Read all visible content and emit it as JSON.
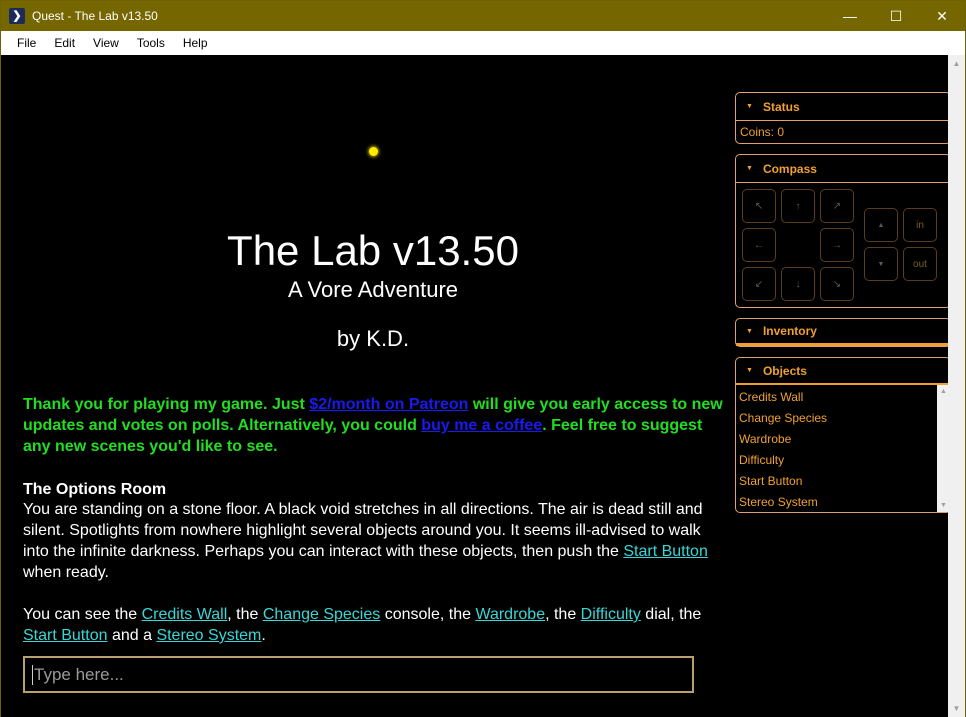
{
  "window": {
    "app_icon": "quest-icon",
    "title": "Quest - The Lab v13.50",
    "controls": {
      "minimize": "—",
      "maximize": "☐",
      "close": "✕"
    }
  },
  "menu": [
    "File",
    "Edit",
    "View",
    "Tools",
    "Help"
  ],
  "main": {
    "sun_icon": "sun-icon",
    "title": "The Lab v13.50",
    "subtitle": "A Vore Adventure",
    "byline": "by K.D.",
    "promo": {
      "text1": "Thank you for playing my game. Just ",
      "link1": "$2/month on Patreon",
      "text2": " will give you early access to new updates and votes on polls. Alternatively, you could ",
      "link2": "buy me a coffee",
      "text3": ". Feel free to suggest any new scenes you'd like to see."
    },
    "room_title": "The Options Room",
    "room_desc": {
      "text1": "You are standing on a stone floor. A black void stretches in all directions. The air is dead still and silent. Spotlights from nowhere highlight several objects around you. It seems ill-advised to walk into the infinite darkness. Perhaps you can interact with these objects, then push the ",
      "link": "Start Button",
      "text2": " when ready."
    },
    "objects_line": {
      "t0": "You can see the ",
      "l0": "Credits Wall",
      "t1": ", the ",
      "l1": "Change Species",
      "t2": " console, the ",
      "l2": "Wardrobe",
      "t3": ", the ",
      "l3": "Difficulty",
      "t4": " dial, the ",
      "l4": "Start Button",
      "t5": " and a ",
      "l5": "Stereo System",
      "t6": "."
    },
    "command": {
      "placeholder": "Type here...",
      "value": ""
    }
  },
  "sidebar": {
    "status": {
      "label": "Status",
      "coins": "Coins: 0"
    },
    "compass": {
      "label": "Compass",
      "nw": "↖",
      "n": "↑",
      "ne": "↗",
      "w": "←",
      "e": "→",
      "sw": "↙",
      "s": "↓",
      "se": "↘",
      "up": "▲",
      "down": "▼",
      "in": "in",
      "out": "out"
    },
    "inventory": {
      "label": "Inventory"
    },
    "objects": {
      "label": "Objects",
      "items": [
        "Credits Wall",
        "Change Species",
        "Wardrobe",
        "Difficulty",
        "Start Button",
        "Stereo System"
      ]
    }
  },
  "colors": {
    "titlebar": "#766600",
    "accent": "#f0a030",
    "promo_text": "#22dd22",
    "promo_link": "#1a1aee",
    "object_link": "#3ad6d6",
    "sun": "#ffea00"
  }
}
